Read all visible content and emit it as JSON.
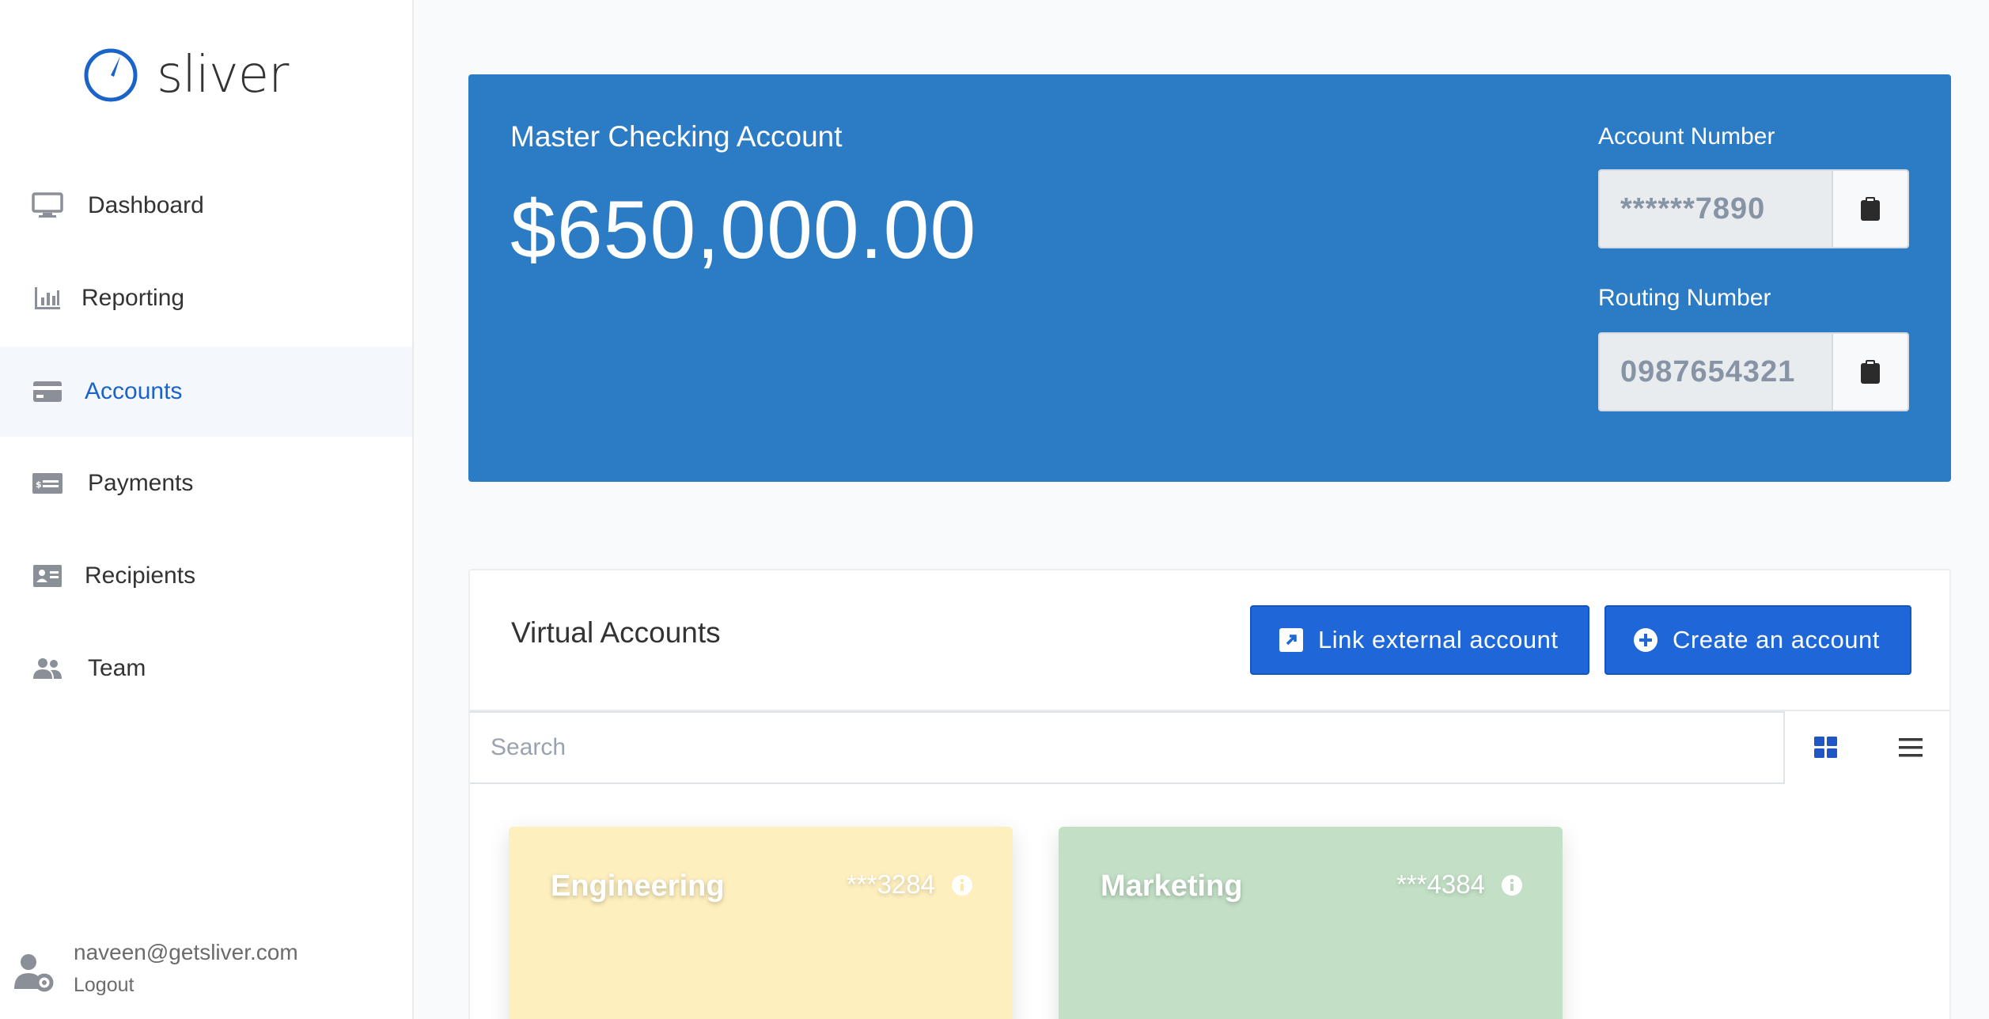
{
  "brand": {
    "name": "sliver",
    "color": "#1a63c9"
  },
  "sidebar": {
    "items": [
      {
        "label": "Dashboard",
        "icon": "monitor-icon",
        "active": false
      },
      {
        "label": "Reporting",
        "icon": "bar-chart-icon",
        "active": false
      },
      {
        "label": "Accounts",
        "icon": "credit-card-icon",
        "active": true
      },
      {
        "label": "Payments",
        "icon": "money-check-icon",
        "active": false
      },
      {
        "label": "Recipients",
        "icon": "address-card-icon",
        "active": false
      },
      {
        "label": "Team",
        "icon": "users-icon",
        "active": false
      }
    ],
    "user": {
      "email": "naveen@getsliver.com",
      "logout_label": "Logout",
      "icon": "user-cog-icon"
    }
  },
  "master": {
    "title": "Master Checking Account",
    "balance": "$650,000.00",
    "account_number_label": "Account Number",
    "account_number": "******7890",
    "routing_number_label": "Routing Number",
    "routing_number": "0987654321",
    "color": "#2c7cc5"
  },
  "virtual": {
    "title": "Virtual Accounts",
    "link_button": "Link external account",
    "create_button": "Create an account",
    "search_placeholder": "Search",
    "cards": [
      {
        "name": "Engineering",
        "number": "***3284",
        "color": "#fdefbe"
      },
      {
        "name": "Marketing",
        "number": "***4384",
        "color": "#c3e0c6"
      }
    ]
  }
}
